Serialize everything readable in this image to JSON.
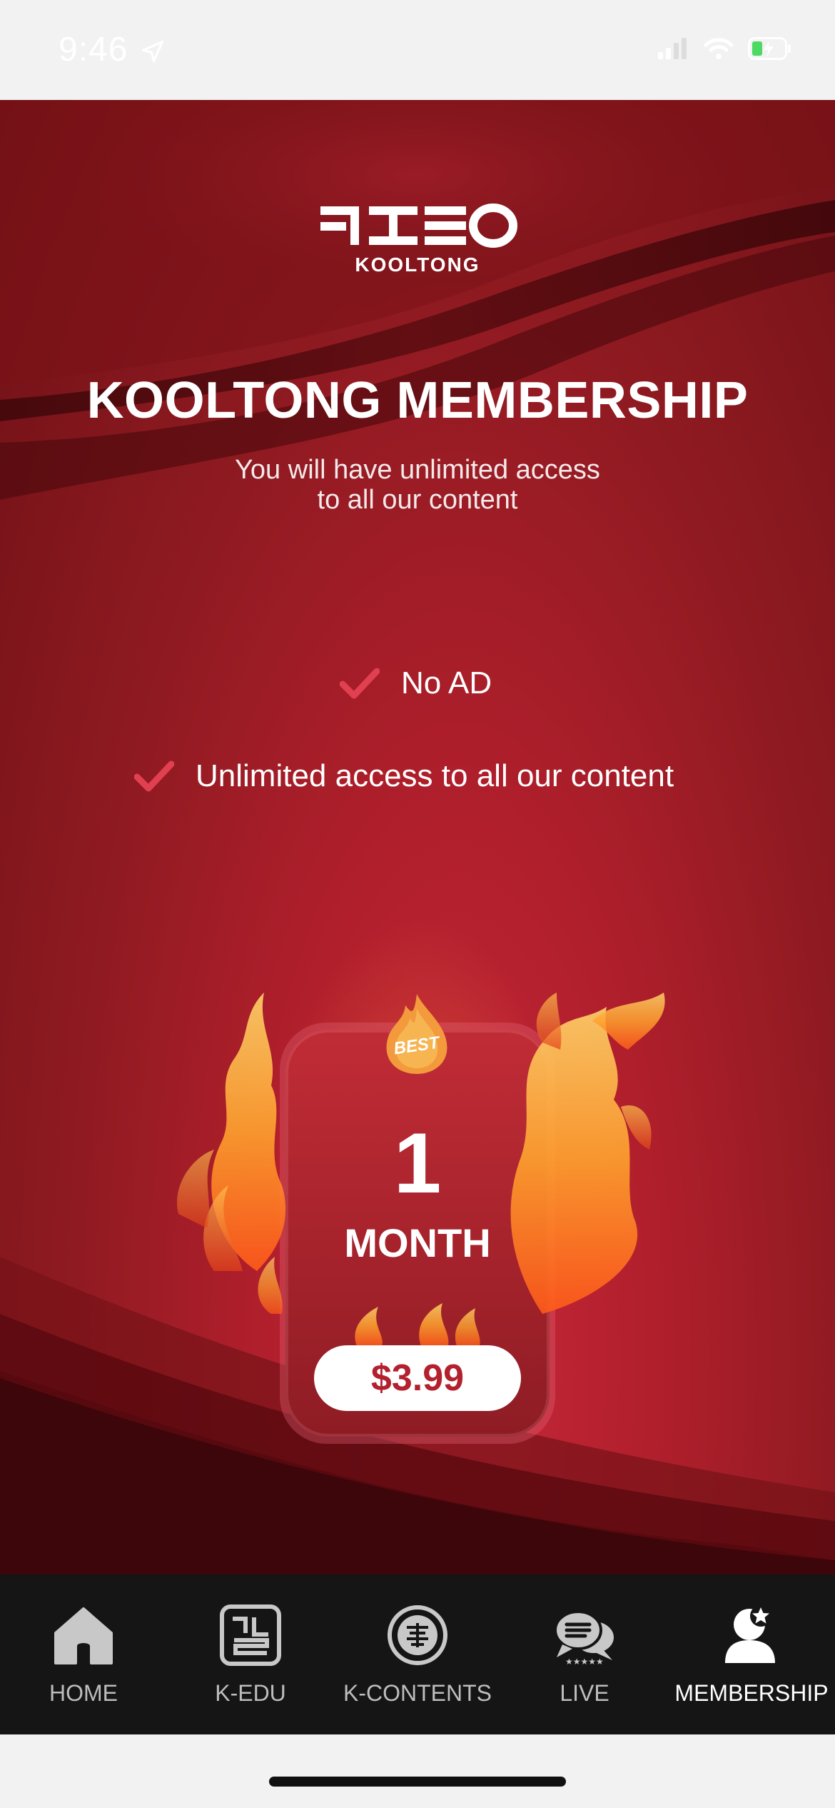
{
  "status_bar": {
    "time": "9:46",
    "battery_icon": "battery-charging-icon",
    "signal_icon": "signal-icon",
    "wifi_icon": "wifi-icon",
    "location_icon": "location-arrow-icon"
  },
  "header": {
    "logo_brand": "KOOLTONG",
    "logo_mark": "logo-mark"
  },
  "membership": {
    "title": "KOOLTONG MEMBERSHIP",
    "subtitle_line1": "You will have unlimited access",
    "subtitle_line2": "to all our content",
    "features": [
      {
        "label": "No AD",
        "icon": "check-icon"
      },
      {
        "label": "Unlimited access to all our content",
        "icon": "check-icon"
      }
    ],
    "plan": {
      "badge": "BEST",
      "duration_value": "1",
      "duration_unit": "MONTH",
      "price": "$3.99"
    }
  },
  "tab_bar": {
    "items": [
      {
        "label": "HOME",
        "icon": "home-icon",
        "active": false
      },
      {
        "label": "K-EDU",
        "icon": "korean-characters-icon",
        "active": false
      },
      {
        "label": "K-CONTENTS",
        "icon": "korean-seal-icon",
        "active": false
      },
      {
        "label": "LIVE",
        "icon": "chat-bubbles-icon",
        "active": false
      },
      {
        "label": "MEMBERSHIP",
        "icon": "member-star-icon",
        "active": true
      }
    ]
  },
  "colors": {
    "accent": "#b3202e",
    "background_red": "#8f1a21",
    "tab_bar": "#151515",
    "flame_orange": "#ff9a2e"
  }
}
